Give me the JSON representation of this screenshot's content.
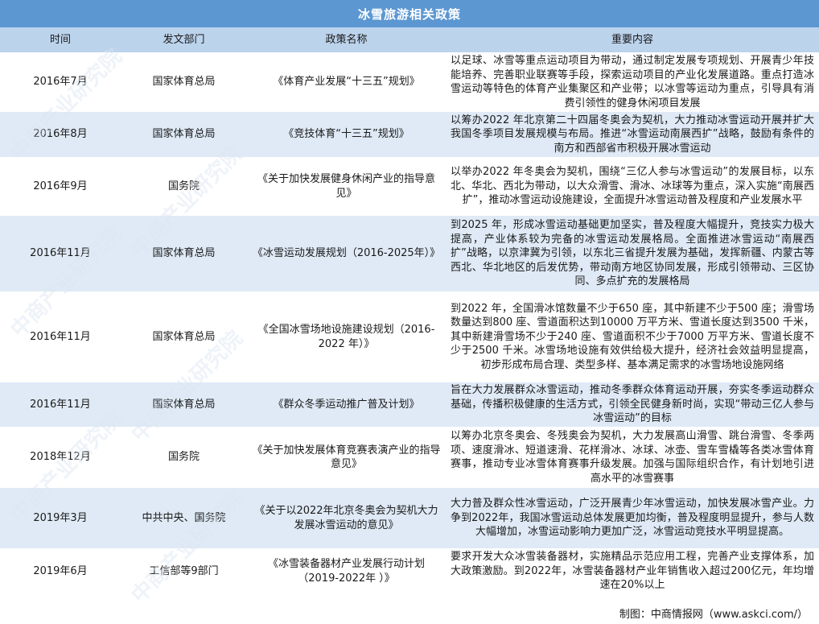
{
  "title": "冰雪旅游相关政策",
  "headers": [
    "时间",
    "发文部门",
    "政策名称",
    "重要内容"
  ],
  "rows": [
    {
      "date": "2016年7月",
      "dept": "国家体育总局",
      "name": "《体育产业发展“十三五”规划》",
      "content": "以足球、冰雪等重点运动项目为带动，通过制定发展专项规划、开展青少年技能培养、完善职业联赛等手段，探索运动项目的产业化发展道路。重点打造冰雪运动等特色的体育产业集聚区和产业带；以冰雪等运动为重点，引导具有消费引领性的健身休闲项目发展"
    },
    {
      "date": "2016年8月",
      "dept": "国家体育总局",
      "name": "《竞技体育“十三五”规划》",
      "content": "以筹办2022 年北京第二十四届冬奥会为契机，大力推动冰雪运动开展并扩大我国冬季项目发展规模与布局。推进“冰雪运动南展西扩”战略，鼓励有条件的南方和西部省市积极开展冰雪运动"
    },
    {
      "date": "2016年9月",
      "dept": "国务院",
      "name": "《关于加快发展健身休闲产业的指导意见》",
      "content": "以举办2022 年冬奥会为契机，围绕“三亿人参与冰雪运动”的发展目标，以东北、华北、西北为带动，以大众滑雪、滑冰、冰球等为重点，深入实施“南展西扩”，推动冰雪运动设施建设，全面提升冰雪运动普及程度和产业发展水平"
    },
    {
      "date": "2016年11月",
      "dept": "国家体育总局",
      "name": "《冰雪运动发展规划（2016-2025年）》",
      "content": "到2025 年，形成冰雪运动基础更加坚实，普及程度大幅提升，竞技实力极大提高，产业体系较为完备的冰雪运动发展格局。全面推进冰雪运动“南展西扩”战略，以京津冀为引领，以东北三省提升发展为基础，发挥新疆、内蒙古等西北、华北地区的后发优势，带动南方地区协同发展，形成引领带动、三区协同、多点扩充的发展格局"
    },
    {
      "date": "2016年11月",
      "dept": "国家体育总局",
      "name": "《全国冰雪场地设施建设规划（2016-2022 年）》",
      "content": "到2022 年，全国滑冰馆数量不少于650 座，其中新建不少于500 座；滑雪场数量达到800 座、雪道面积达到10000 万平方米、雪道长度达到3500 千米，其中新建滑雪场不少于240 座、雪道面积不少于7000 万平方米、雪道长度不少于2500 千米。冰雪场地设施有效供给极大提升，经济社会效益明显提高，初步形成布局合理、类型多样、基本满足需求的冰雪场地设施网络"
    },
    {
      "date": "2016年11月",
      "dept": "国家体育总局",
      "name": "《群众冬季运动推广普及计划》",
      "content": "旨在大力发展群众冰雪运动，推动冬季群众体育运动开展，夯实冬季运动群众基础，传播积极健康的生活方式，引领全民健身新时尚，实现“带动三亿人参与冰雪运动”的目标"
    },
    {
      "date": "2018年12月",
      "dept": "国务院",
      "name": "《关于加快发展体育竞赛表演产业的指导意见》",
      "content": "以筹办北京冬奥会、冬残奥会为契机，大力发展高山滑雪、跳台滑雪、冬季两项、速度滑冰、短道速滑、花样滑冰、冰球、冰壶、雪车雪橇等各类冰雪体育赛事，推动专业冰雪体育赛事升级发展。加强与国际组织合作，有计划地引进高水平的冰雪赛事"
    },
    {
      "date": "2019年3月",
      "dept": "中共中央、国务院",
      "name": "《关于以2022年北京冬奥会为契机大力发展冰雪运动的意见》",
      "content": "大力普及群众性冰雪运动，广泛开展青少年冰雪运动，加快发展冰雪产业。力争到2022年，我国冰雪运动总体发展更加均衡，普及程度明显提升，参与人数大幅增加，冰雪运动影响力更加广泛，冰雪运动竞技水平明显提高。"
    },
    {
      "date": "2019年6月",
      "dept": "工信部等9部门",
      "name": "《冰雪装备器材产业发展行动计划（2019-2022年 ）》",
      "content": "要求开发大众冰雪装备器材，实施精品示范应用工程，完善产业支撑体系，加大政策激励。到2022年，冰雪装备器材产业年销售收入超过200亿元，年均增速在20%以上"
    }
  ],
  "footer": "制图：中商情报网（www.askci.com/）",
  "watermark": "中商产业研究院",
  "colors": {
    "title_bg": "#5c97d2",
    "header_bg": "#bcd3ec",
    "row_alt_bg": "#dfeaf6"
  }
}
